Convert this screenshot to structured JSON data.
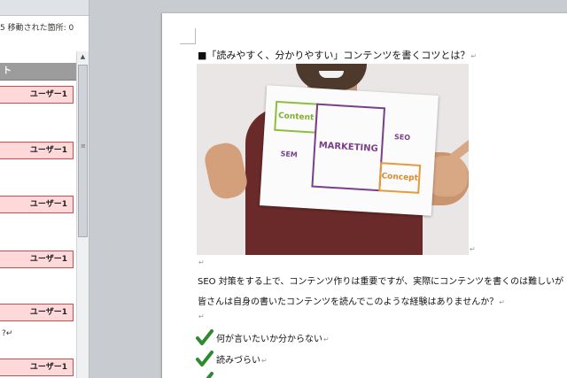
{
  "revision_pane": {
    "summary": "5 移動された箇所: 0",
    "header_label": "ト",
    "items": [
      {
        "label": "ユーザー1"
      },
      {
        "label": "ユーザー1"
      },
      {
        "label": "ユーザー1"
      },
      {
        "label": "ユーザー1"
      },
      {
        "label": "ユーザー1"
      },
      {
        "label": "ユーザー1"
      }
    ],
    "fragment": "?↵"
  },
  "document": {
    "heading": "■「読みやすく、分かりやすい」コンテンツを書くコツとは？",
    "return_mark": "↵",
    "image_board": {
      "content": "Content",
      "marketing": "MARKETING",
      "seo": "SEO",
      "sem": "SEM",
      "concept": "Concept"
    },
    "paragraph_1": "SEO 対策をする上で、コンテンツ作りは重要ですが、実際にコンテンツを書くのは難しいが",
    "paragraph_2": "皆さんは自身の書いたコンテンツを読んでこのような経験はありませんか？",
    "checklist": [
      {
        "text": "何が言いたいか分からない"
      },
      {
        "text": "読みづらい"
      }
    ]
  },
  "colors": {
    "revision_fill": "#ffd9d9",
    "revision_border": "#d24a4a",
    "check_green": "#2f8a2f"
  }
}
